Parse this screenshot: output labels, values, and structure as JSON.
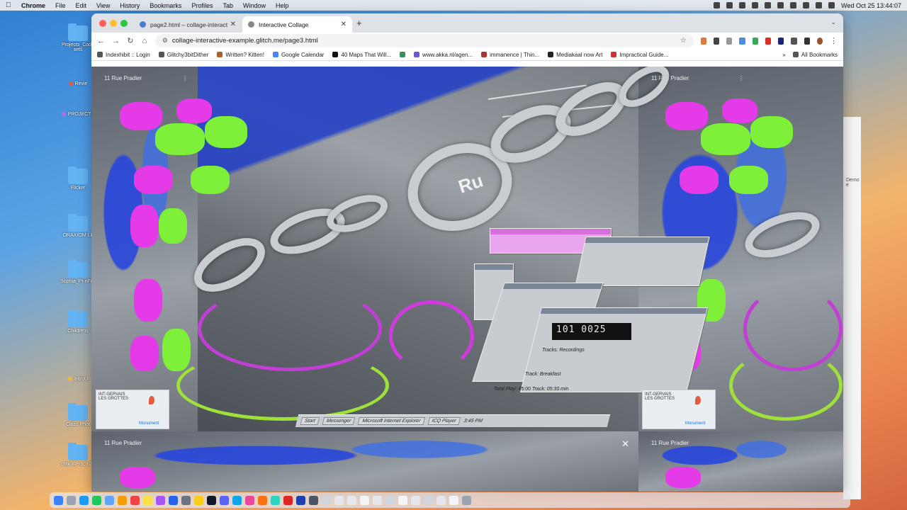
{
  "menubar": {
    "app": "Chrome",
    "items": [
      "File",
      "Edit",
      "View",
      "History",
      "Bookmarks",
      "Profiles",
      "Tab",
      "Window",
      "Help"
    ],
    "clock": "Wed Oct 25  13:44:07"
  },
  "desktop": {
    "icons": [
      {
        "label": "Projects_Code sets"
      },
      {
        "label": "Revie",
        "dot": "#e5584c"
      },
      {
        "label": "PROJECTS",
        "dot": "#b56ae0"
      },
      {
        "label": "Flicker"
      },
      {
        "label": "ORAXIOM LL"
      },
      {
        "label": "Sophia_Pr nFile"
      },
      {
        "label": "Childrens"
      },
      {
        "label": "IntroU",
        "dot": "#f2b43a"
      },
      {
        "label": "Class Phot"
      },
      {
        "label": "criticalPracti 23"
      }
    ]
  },
  "browser": {
    "tabs": [
      {
        "title": "page2.html – collage-interact",
        "active": false
      },
      {
        "title": "Interactive Collage",
        "active": true
      }
    ],
    "url": "collage-interactive-example.glitch.me/page3.html",
    "bookmarks": [
      "Indexhibit :: Login",
      "Glitchy3bitDither",
      "Written? Kitten!",
      "Google Calendar",
      "40 Maps That Will...",
      "www.akka.nl/agen...",
      "immanence | Thin...",
      "Mediakaal now Art",
      "Impractical Guide..."
    ],
    "all_bookmarks": "All Bookmarks"
  },
  "collage": {
    "tile_label": "11 Rue Pradier",
    "lcd": "101 0025",
    "map_label_1": "INT-GERVAIS",
    "map_label_2": "LES GROTTES",
    "map_label_3": "Monument",
    "street_text": "Ru",
    "taskbar_items": [
      "Start",
      "Messenger",
      "Microsoft Internet Explorer",
      "ICQ Player",
      "3:45 PM"
    ],
    "retro_field_1": "Tracks: Recordings",
    "retro_field_2": "Track: Breakfast",
    "retro_status": "Total Play: 45:00  Track: 05:30 min"
  },
  "right_window": {
    "text": "Demo e"
  }
}
